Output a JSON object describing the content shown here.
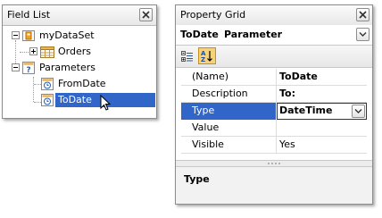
{
  "field_list": {
    "title": "Field List",
    "close_icon": "close-icon",
    "items": [
      {
        "label": "myDataSet",
        "icon": "dataset-icon"
      },
      {
        "label": "Orders",
        "icon": "table-icon"
      },
      {
        "label": "Parameters",
        "icon": "parameters-icon"
      },
      {
        "label": "FromDate",
        "icon": "date-parameter-icon"
      },
      {
        "label": "ToDate",
        "icon": "date-parameter-icon",
        "selected": true
      }
    ]
  },
  "property_grid": {
    "title": "Property Grid",
    "close_icon": "close-icon",
    "selected_object": {
      "name": "ToDate",
      "type": "Parameter"
    },
    "toolbar": {
      "categorized_icon": "categorized-icon",
      "alphabetical_icon": "sort-az-icon"
    },
    "rows": [
      {
        "name": "(Name)",
        "value": "ToDate",
        "bold": true
      },
      {
        "name": "Description",
        "value": "To:",
        "bold": true
      },
      {
        "name": "Type",
        "value": "DateTime",
        "bold": true,
        "selected": true
      },
      {
        "name": "Value",
        "value": ""
      },
      {
        "name": "Visible",
        "value": "Yes"
      }
    ],
    "description_title": "Type"
  },
  "colors": {
    "selection": "#3165c8",
    "toolbar_active": "#f6d27c"
  }
}
